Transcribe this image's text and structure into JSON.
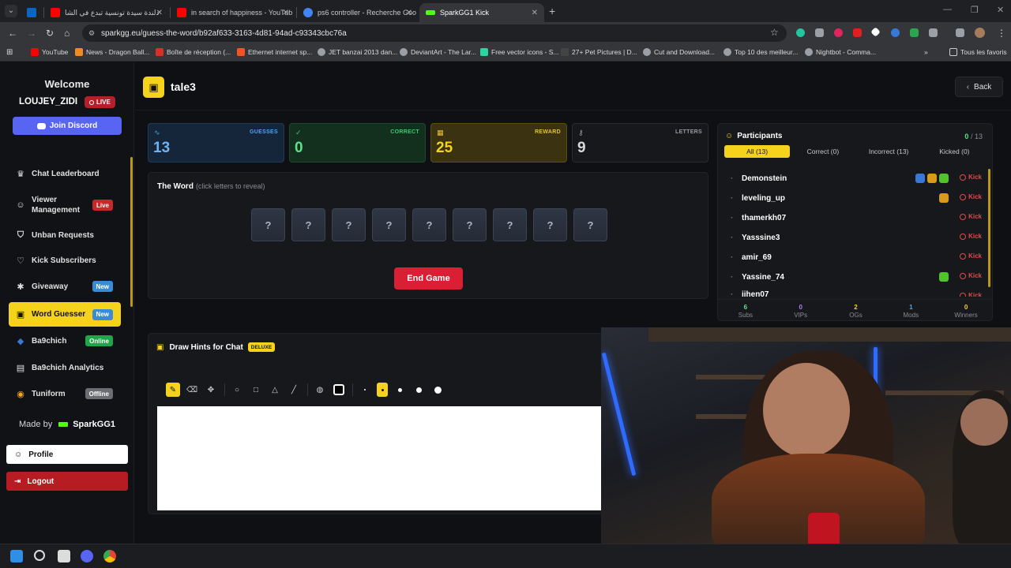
{
  "browser": {
    "tabs": [
      {
        "label": "",
        "color": "#0a66c2"
      },
      {
        "label": "دلندة سيدة تونسية تبدع في الشا",
        "color": "#ff0000"
      },
      {
        "label": "in search of happiness - YouTub",
        "color": "#ff0000"
      },
      {
        "label": "ps6 controller - Recherche Goo",
        "color": "#4285f4"
      },
      {
        "label": "SparkGG1 Kick",
        "color": "#53fc18"
      }
    ],
    "url": "sparkgg.eu/guess-the-word/b92af633-3163-4d81-94ad-c93343cbc76a",
    "bookmarks": [
      {
        "label": "YouTube",
        "color": "#ff0000"
      },
      {
        "label": "News - Dragon Ball...",
        "color": "#f08a24"
      },
      {
        "label": "Boîte de réception (...",
        "color": "#d93025"
      },
      {
        "label": "Ethernet internet sp...",
        "color": "#f35325"
      },
      {
        "label": "JET banzai 2013 dan...",
        "color": "#9aa0a6"
      },
      {
        "label": "DeviantArt - The Lar...",
        "color": "#9aa0a6"
      },
      {
        "label": "Free vector icons - S...",
        "color": "#2bd4a0"
      },
      {
        "label": "27+ Pet Pictures | D...",
        "color": "#222222"
      },
      {
        "label": "Cut and Download...",
        "color": "#9aa0a6"
      },
      {
        "label": "Top 10 des meilleur...",
        "color": "#9aa0a6"
      },
      {
        "label": "Nightbot - Comma...",
        "color": "#9aa0a6"
      }
    ],
    "all_bookmarks": "Tous les favoris"
  },
  "sidebar": {
    "welcome": "Welcome",
    "username": "LOUJEY_ZIDI",
    "live_label": "LIVE",
    "discord_label": "Join Discord",
    "items": [
      {
        "label": "Chat Leaderboard",
        "icon": "trophy-icon",
        "glyph": "♛",
        "badge": ""
      },
      {
        "label": "Viewer Management",
        "icon": "users-icon",
        "glyph": "☺",
        "badge": "Live",
        "badge_type": "live"
      },
      {
        "label": "Unban Requests",
        "icon": "shield-icon",
        "glyph": "⛉",
        "badge": ""
      },
      {
        "label": "Kick Subscribers",
        "icon": "heart-icon",
        "glyph": "♡",
        "badge": ""
      },
      {
        "label": "Giveaway",
        "icon": "gift-icon",
        "glyph": "✱",
        "badge": "New",
        "badge_type": "new"
      },
      {
        "label": "Word Guesser",
        "icon": "gamepad-icon",
        "glyph": "▣",
        "badge": "New",
        "badge_type": "new",
        "active": true
      },
      {
        "label": "Ba9chich",
        "icon": "ba9chich-logo-icon",
        "glyph": "◆",
        "badge": "Online",
        "badge_type": "online"
      },
      {
        "label": "Ba9chich Analytics",
        "icon": "analytics-icon",
        "glyph": "▤",
        "badge": ""
      },
      {
        "label": "Tuniform",
        "icon": "tuniform-logo-icon",
        "glyph": "◉",
        "badge": "Offline",
        "badge_type": "offline"
      }
    ],
    "made_by": "Made by",
    "brand": "SparkGG1",
    "profile_label": "Profile",
    "logout_label": "Logout"
  },
  "header": {
    "title": "tale3",
    "back_label": "Back"
  },
  "stats": {
    "guesses": {
      "label": "GUESSES",
      "value": "13"
    },
    "correct": {
      "label": "CORRECT",
      "value": "0"
    },
    "reward": {
      "label": "REWARD",
      "value": "25"
    },
    "letters": {
      "label": "LETTERS",
      "value": "9"
    }
  },
  "word": {
    "title": "The Word",
    "hint": "(click letters to reveal)",
    "tiles": [
      "?",
      "?",
      "?",
      "?",
      "?",
      "?",
      "?",
      "?",
      "?"
    ],
    "end_label": "End Game"
  },
  "participants": {
    "title": "Participants",
    "correct_count": "0",
    "separator": "/",
    "total": "13",
    "tabs": [
      {
        "label": "All (13)",
        "active": true
      },
      {
        "label": "Correct (0)"
      },
      {
        "label": "Incorrect (13)"
      },
      {
        "label": "Kicked (0)"
      }
    ],
    "kick_label": "Kick",
    "rows": [
      {
        "name": "Demonstein",
        "badges": [
          "mod",
          "og",
          "sub"
        ]
      },
      {
        "name": "leveling_up",
        "badges": [
          "og"
        ]
      },
      {
        "name": "thamerkh07",
        "badges": []
      },
      {
        "name": "Yasssine3",
        "badges": []
      },
      {
        "name": "amir_69",
        "badges": []
      },
      {
        "name": "Yassine_74",
        "badges": [
          "sub"
        ]
      },
      {
        "name": "jihen07",
        "badges": []
      }
    ],
    "footer": [
      {
        "value": "6",
        "label": "Subs",
        "color": "#5fe08b"
      },
      {
        "value": "0",
        "label": "VIPs",
        "color": "#b07cf0"
      },
      {
        "value": "2",
        "label": "OGs",
        "color": "#f5d21c"
      },
      {
        "value": "1",
        "label": "Mods",
        "color": "#5aa1e6"
      },
      {
        "value": "0",
        "label": "Winners",
        "color": "#f5d21c"
      }
    ]
  },
  "draw": {
    "title": "Draw Hints for Chat",
    "badge": "DELUXE"
  }
}
